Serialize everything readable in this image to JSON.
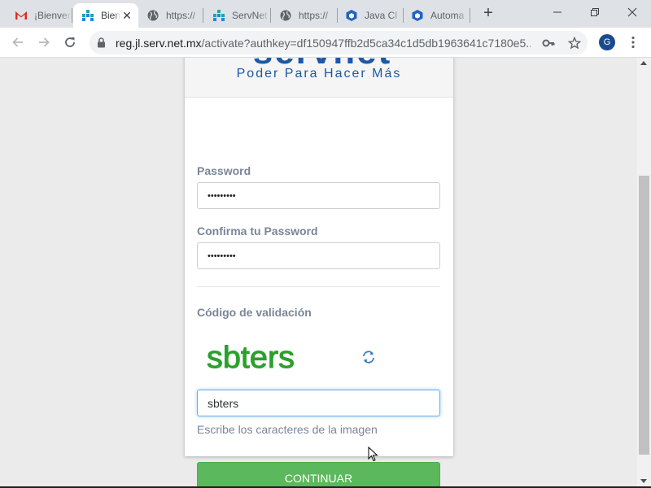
{
  "browser": {
    "tabs": [
      {
        "label": "¡Bienvenido",
        "icon": "gmail-icon"
      },
      {
        "label": "Bienvenido",
        "icon": "servnet-icon",
        "active": true
      },
      {
        "label": "https://",
        "icon": "globe-icon"
      },
      {
        "label": "ServNet",
        "icon": "servnet-icon"
      },
      {
        "label": "https://",
        "icon": "globe-icon"
      },
      {
        "label": "Java Cl",
        "icon": "cube-icon"
      },
      {
        "label": "Automa",
        "icon": "cube-icon"
      }
    ],
    "url_host": "reg.jl.serv.net.mx",
    "url_path": "/activate?authkey=df150947ffb2d5ca34c1d5db1963641c7180e5...",
    "profile_initial": "G"
  },
  "page": {
    "brand_tagline": "Poder Para Hacer Más",
    "password_label": "Password",
    "password_value": "•••••••••",
    "confirm_label": "Confirma tu Password",
    "confirm_value": "•••••••••",
    "captcha_label": "Código de validación",
    "captcha_text": "sbters",
    "captcha_input_value": "sbters",
    "captcha_hint": "Escribe los caracteres de la imagen",
    "continue_label": "CONTINUAR"
  },
  "colors": {
    "brand": "#1b5aa6",
    "button": "#5cb85c",
    "captcha": "#2ca02c"
  }
}
